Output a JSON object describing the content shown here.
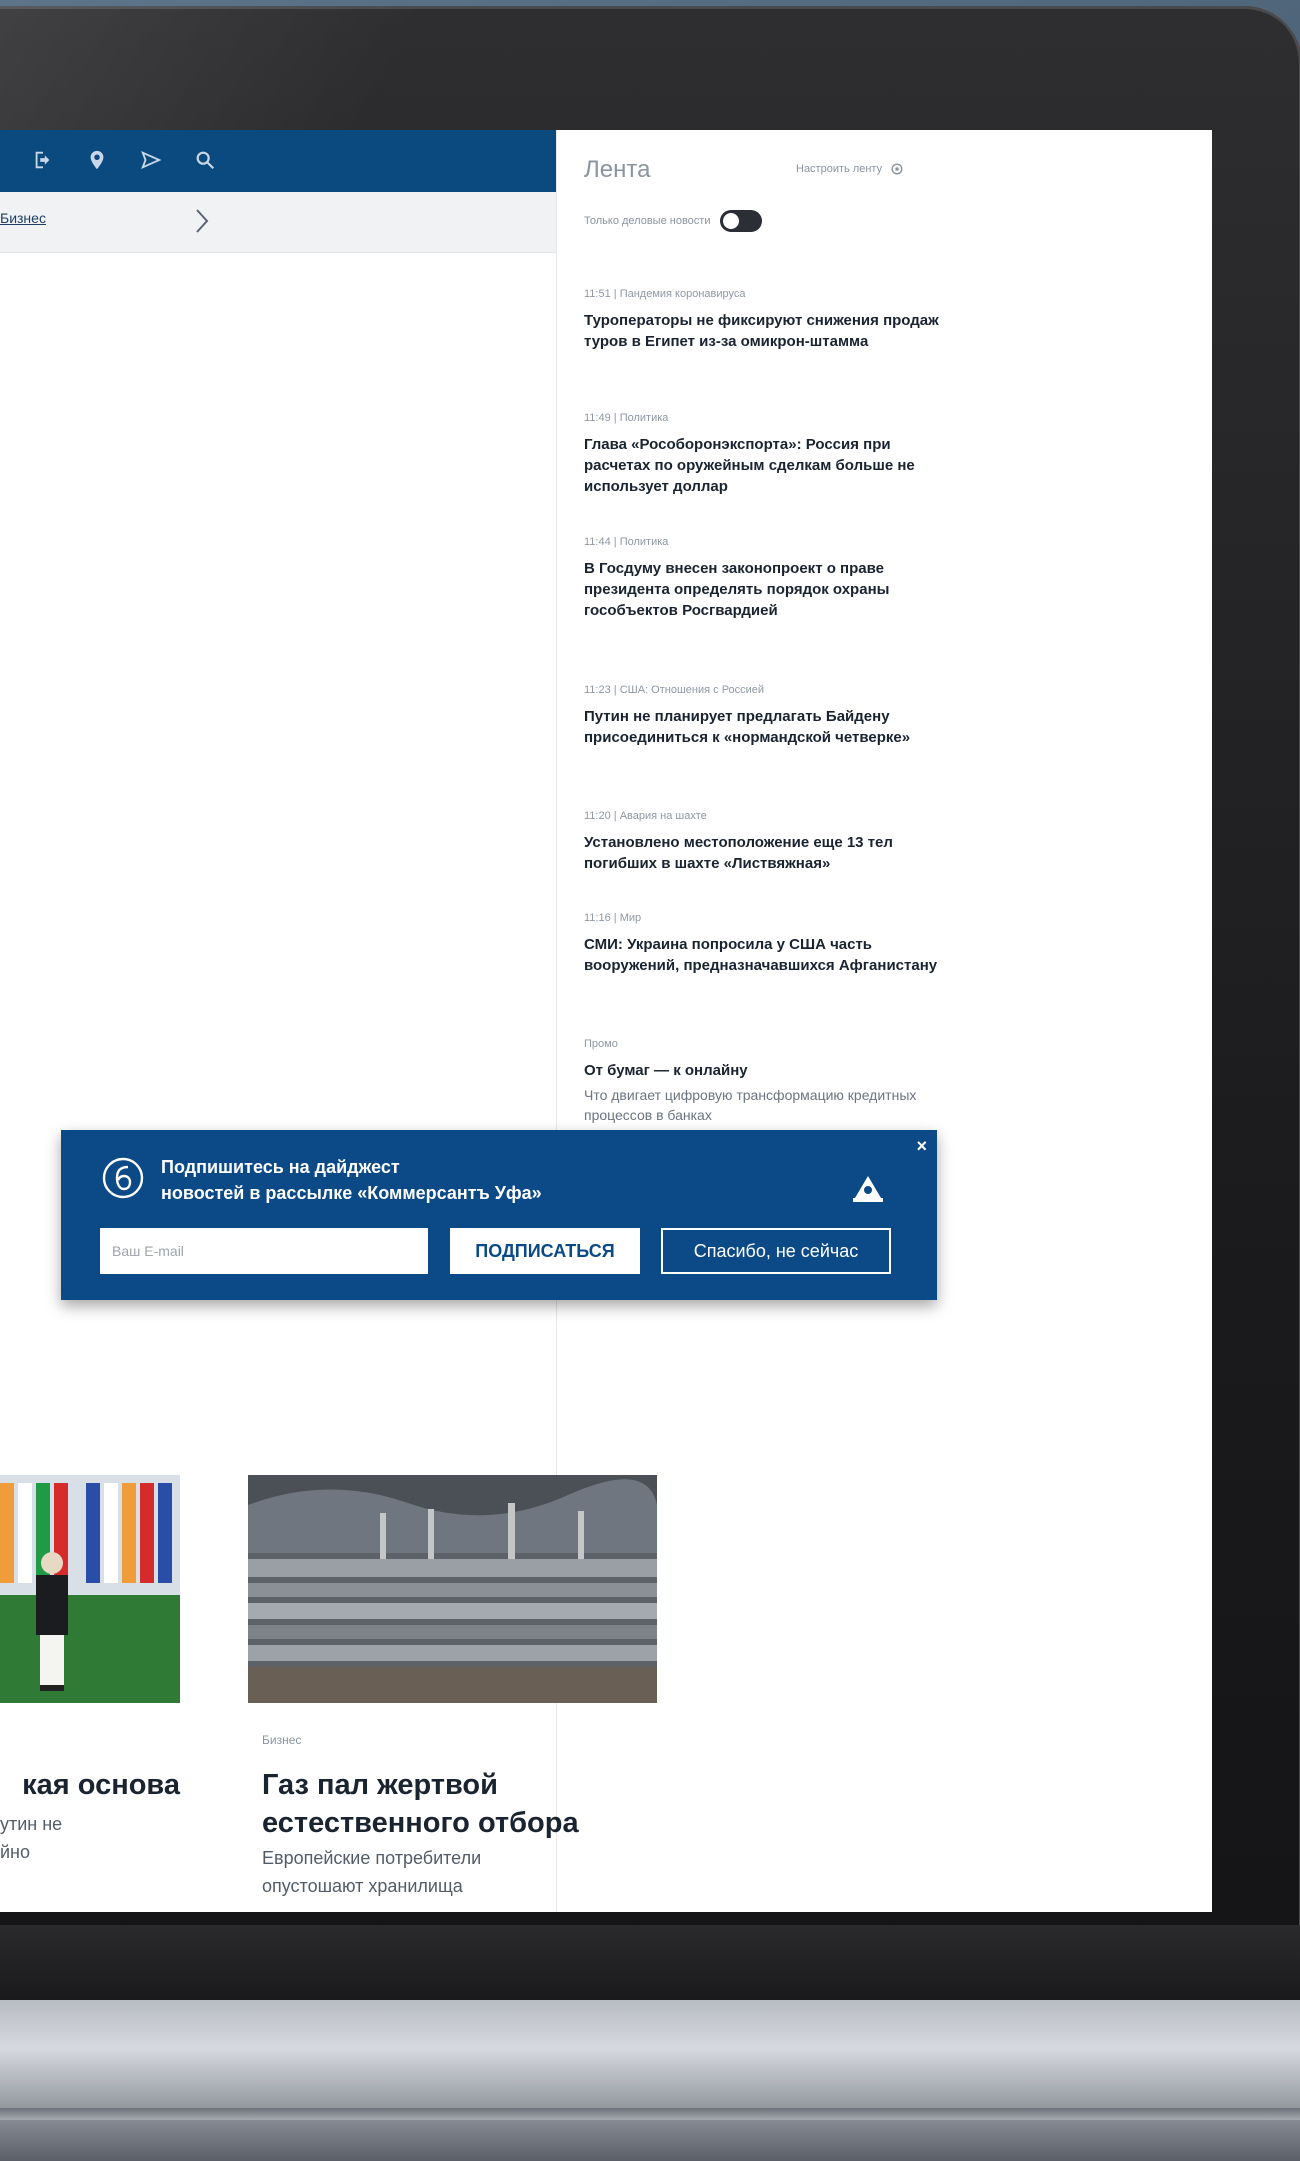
{
  "colors": {
    "brand_blue": "#0b4a7e",
    "banner_blue": "#0b4a86",
    "text_dark": "#1a2330",
    "text_muted": "#8a94a1"
  },
  "header": {
    "icons": [
      "login-icon",
      "location-icon",
      "send-icon",
      "search-icon"
    ]
  },
  "subnav": {
    "link_label": "Бизнес"
  },
  "feed": {
    "title": "Лента",
    "settings_label": "Настроить ленту",
    "toggle_label": "Только деловые новости",
    "items": [
      {
        "time": "11:51",
        "category": "Пандемия коронавируса",
        "title": "Туроператоры не фиксируют снижения продаж туров в Египет из-за омикрон-штамма"
      },
      {
        "time": "11:49",
        "category": "Политика",
        "title": "Глава «Рособоронэкспорта»: Россия при расчетах по оружейным сделкам больше не использует доллар"
      },
      {
        "time": "11:44",
        "category": "Политика",
        "title": "В Госдуму внесен законопроект о праве президента определять порядок охраны гособъектов Росгвардией"
      },
      {
        "time": "11:23",
        "category": "США: Отношения с Россией",
        "title": "Путин не планирует предлагать Байдену присоединиться к «нормандской четверке»"
      },
      {
        "time": "11:20",
        "category": "Авария на шахте",
        "title": "Установлено местоположение еще 13 тел погибших в шахте «Листвяжная»"
      },
      {
        "time": "11:16",
        "category": "Мир",
        "title": "СМИ: Украина попросила у США часть вооружений, предназначавшихся Афганистану"
      },
      {
        "time": "",
        "category": "Промо",
        "title": "От бумаг — к онлайну",
        "subtitle": "Что двигает цифровую трансформацию кредитных процессов в банках"
      }
    ]
  },
  "subscribe": {
    "heading_line1": "Подпишитесь на дайджест",
    "heading_line2": "новостей в рассылке «Коммерсантъ Уфа»",
    "email_placeholder": "Ваш E-mail",
    "submit_label": "ПОДПИСАТЬСЯ",
    "decline_label": "Спасибо, не сейчас",
    "close_label": "×"
  },
  "articles": [
    {
      "category": "",
      "title": "кая основа",
      "lead_line1": "утин не",
      "lead_line2": "йно"
    },
    {
      "category": "Бизнес",
      "title": "Газ пал жертвой естественного отбора",
      "lead": "Европейские потребители опустошают хранилища"
    }
  ]
}
